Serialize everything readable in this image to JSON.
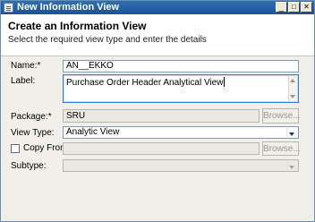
{
  "window": {
    "title": "New Information View",
    "controls": {
      "minimize": "_",
      "maximize": "□",
      "close": "✕"
    }
  },
  "header": {
    "title": "Create an Information View",
    "subtitle": "Select the required view type and enter the details"
  },
  "form": {
    "name": {
      "label": "Name:*",
      "value": "AN__EKKO"
    },
    "label_field": {
      "label": "Label:",
      "value": "Purchase Order Header Analytical View"
    },
    "package": {
      "label": "Package:*",
      "value": "SRU",
      "browse": "Browse..."
    },
    "view_type": {
      "label": "View Type:",
      "value": "Analytic View"
    },
    "copy_from": {
      "label": "Copy From:",
      "value": "",
      "checked": false,
      "browse": "Browse..."
    },
    "subtype": {
      "label": "Subtype:",
      "value": ""
    }
  }
}
